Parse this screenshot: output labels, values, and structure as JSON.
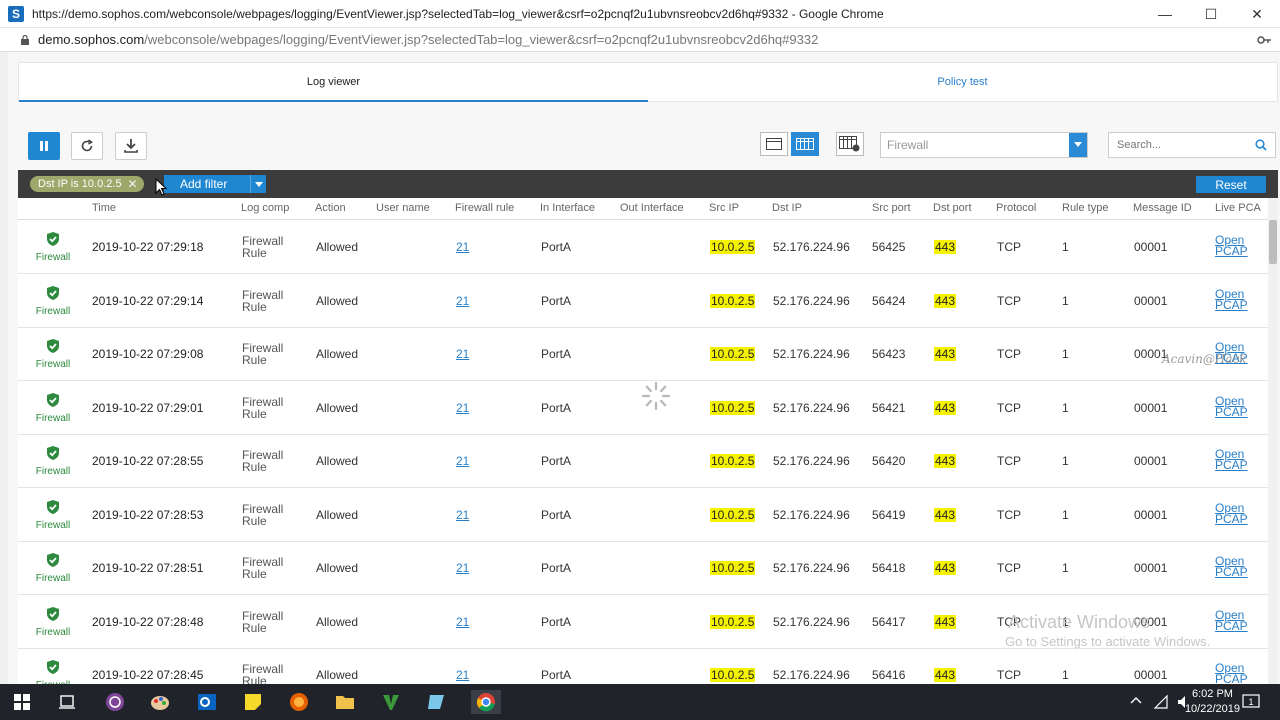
{
  "browser": {
    "title": "https://demo.sophos.com/webconsole/webpages/logging/EventViewer.jsp?selectedTab=log_viewer&csrf=o2pcnqf2u1ubvnsreobcv2d6hq#9332 - Google Chrome",
    "url_host": "demo.sophos.com",
    "url_path": "/webconsole/webpages/logging/EventViewer.jsp?selectedTab=log_viewer&csrf=o2pcnqf2u1ubvnsreobcv2d6hq#9332"
  },
  "tabs": {
    "log_viewer": "Log viewer",
    "policy_test": "Policy test"
  },
  "toolbar": {
    "module_select": "Firewall",
    "search_placeholder": "Search..."
  },
  "filterbar": {
    "chip": "Dst IP is 10.0.2.5",
    "chip_close": "✕",
    "add_filter": "Add filter",
    "reset": "Reset"
  },
  "columns": {
    "time": "Time",
    "log_comp": "Log comp",
    "action": "Action",
    "user_name": "User name",
    "firewall_rule": "Firewall rule",
    "in_interface": "In Interface",
    "out_interface": "Out Interface",
    "src_ip": "Src IP",
    "dst_ip": "Dst IP",
    "src_port": "Src port",
    "dst_port": "Dst port",
    "protocol": "Protocol",
    "rule_type": "Rule type",
    "message_id": "Message ID",
    "live_pcap": "Live PCA"
  },
  "rows": [
    {
      "icon_label": "Firewall",
      "time": "2019-10-22 07:29:18",
      "log_comp": "Firewall Rule",
      "action": "Allowed",
      "rule": "21",
      "in_if": "PortA",
      "src_ip": "10.0.2.5",
      "dst_ip": "52.176.224.96",
      "src_port": "56425",
      "dst_port": "443",
      "protocol": "TCP",
      "rule_type": "1",
      "message_id": "00001",
      "pcap": "Open PCAP"
    },
    {
      "icon_label": "Firewall",
      "time": "2019-10-22 07:29:14",
      "log_comp": "Firewall Rule",
      "action": "Allowed",
      "rule": "21",
      "in_if": "PortA",
      "src_ip": "10.0.2.5",
      "dst_ip": "52.176.224.96",
      "src_port": "56424",
      "dst_port": "443",
      "protocol": "TCP",
      "rule_type": "1",
      "message_id": "00001",
      "pcap": "Open PCAP"
    },
    {
      "icon_label": "Firewall",
      "time": "2019-10-22 07:29:08",
      "log_comp": "Firewall Rule",
      "action": "Allowed",
      "rule": "21",
      "in_if": "PortA",
      "src_ip": "10.0.2.5",
      "dst_ip": "52.176.224.96",
      "src_port": "56423",
      "dst_port": "443",
      "protocol": "TCP",
      "rule_type": "1",
      "message_id": "00001",
      "pcap": "Open PCAP"
    },
    {
      "icon_label": "Firewall",
      "time": "2019-10-22 07:29:01",
      "log_comp": "Firewall Rule",
      "action": "Allowed",
      "rule": "21",
      "in_if": "PortA",
      "src_ip": "10.0.2.5",
      "dst_ip": "52.176.224.96",
      "src_port": "56421",
      "dst_port": "443",
      "protocol": "TCP",
      "rule_type": "1",
      "message_id": "00001",
      "pcap": "Open PCAP"
    },
    {
      "icon_label": "Firewall",
      "time": "2019-10-22 07:28:55",
      "log_comp": "Firewall Rule",
      "action": "Allowed",
      "rule": "21",
      "in_if": "PortA",
      "src_ip": "10.0.2.5",
      "dst_ip": "52.176.224.96",
      "src_port": "56420",
      "dst_port": "443",
      "protocol": "TCP",
      "rule_type": "1",
      "message_id": "00001",
      "pcap": "Open PCAP"
    },
    {
      "icon_label": "Firewall",
      "time": "2019-10-22 07:28:53",
      "log_comp": "Firewall Rule",
      "action": "Allowed",
      "rule": "21",
      "in_if": "PortA",
      "src_ip": "10.0.2.5",
      "dst_ip": "52.176.224.96",
      "src_port": "56419",
      "dst_port": "443",
      "protocol": "TCP",
      "rule_type": "1",
      "message_id": "00001",
      "pcap": "Open PCAP"
    },
    {
      "icon_label": "Firewall",
      "time": "2019-10-22 07:28:51",
      "log_comp": "Firewall Rule",
      "action": "Allowed",
      "rule": "21",
      "in_if": "PortA",
      "src_ip": "10.0.2.5",
      "dst_ip": "52.176.224.96",
      "src_port": "56418",
      "dst_port": "443",
      "protocol": "TCP",
      "rule_type": "1",
      "message_id": "00001",
      "pcap": "Open PCAP"
    },
    {
      "icon_label": "Firewall",
      "time": "2019-10-22 07:28:48",
      "log_comp": "Firewall Rule",
      "action": "Allowed",
      "rule": "21",
      "in_if": "PortA",
      "src_ip": "10.0.2.5",
      "dst_ip": "52.176.224.96",
      "src_port": "56417",
      "dst_port": "443",
      "protocol": "TCP",
      "rule_type": "1",
      "message_id": "00001",
      "pcap": "Open PCAP"
    },
    {
      "icon_label": "Firewall",
      "time": "2019-10-22 07:28:45",
      "log_comp": "Firewall Rule",
      "action": "Allowed",
      "rule": "21",
      "in_if": "PortA",
      "src_ip": "10.0.2.5",
      "dst_ip": "52.176.224.96",
      "src_port": "56416",
      "dst_port": "443",
      "protocol": "TCP",
      "rule_type": "1",
      "message_id": "00001",
      "pcap": "Open PCAP"
    }
  ],
  "overlay": {
    "activate_title": "Activate Windows",
    "activate_sub": "Go to Settings to activate Windows.",
    "signature": "Acavin@Hack"
  },
  "taskbar": {
    "time": "6:02 PM",
    "date": "10/22/2019"
  },
  "colors": {
    "accent": "#1f86d1",
    "highlight": "#f5f200",
    "ok_green": "#2d8a3e"
  }
}
